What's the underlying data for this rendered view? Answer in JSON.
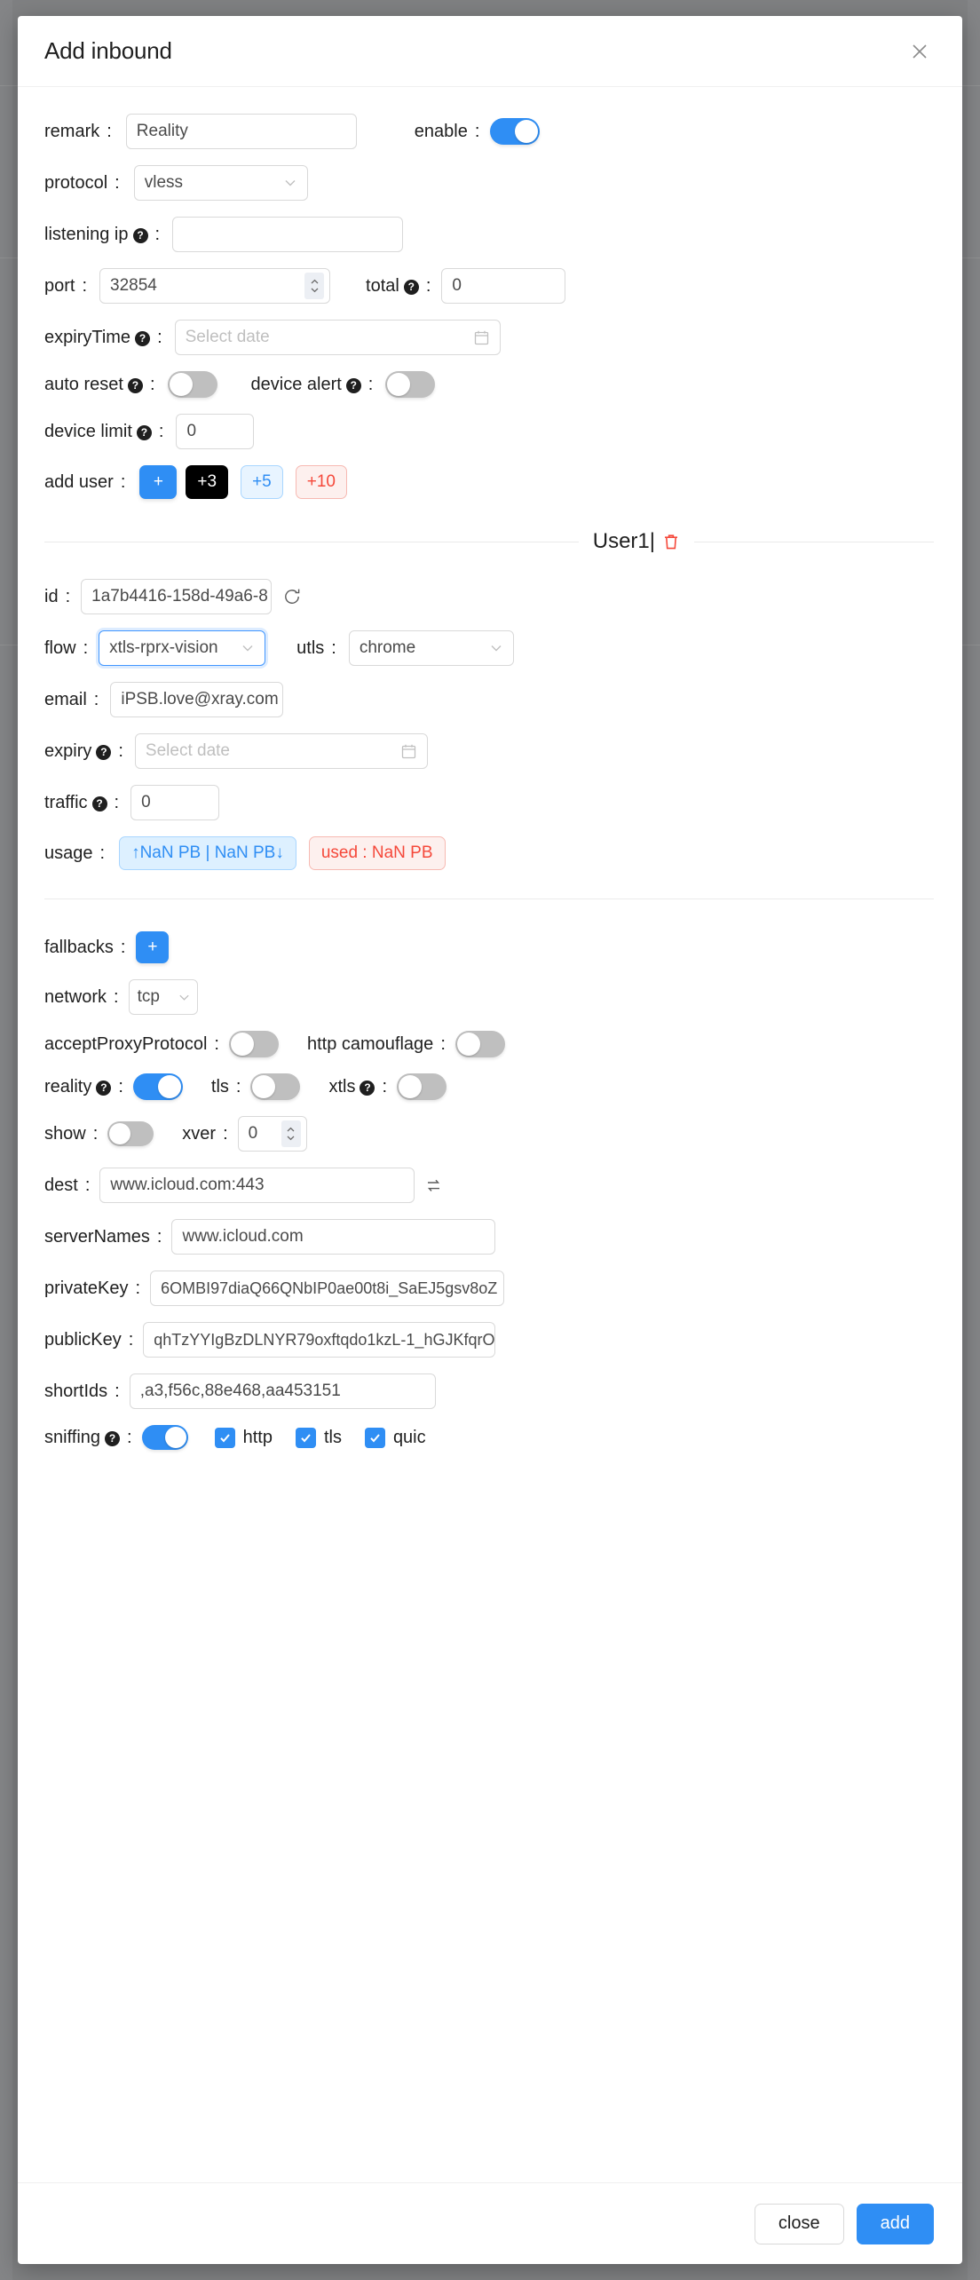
{
  "modal": {
    "title": "Add inbound",
    "close_icon": "close-icon"
  },
  "form": {
    "remark": {
      "label": "remark",
      "value": "Reality"
    },
    "enable": {
      "label": "enable",
      "state": "on"
    },
    "protocol": {
      "label": "protocol",
      "value": "vless"
    },
    "listening_ip": {
      "label": "listening ip",
      "value": ""
    },
    "port": {
      "label": "port",
      "value": "32854"
    },
    "total": {
      "label": "total",
      "value": "0"
    },
    "expiry_time": {
      "label": "expiryTime",
      "placeholder": "Select date",
      "value": ""
    },
    "auto_reset": {
      "label": "auto reset",
      "state": "off"
    },
    "device_alert": {
      "label": "device alert",
      "state": "off"
    },
    "device_limit": {
      "label": "device limit",
      "value": "0"
    },
    "add_user": {
      "label": "add user",
      "buttons": [
        {
          "text": "+",
          "style": "blue"
        },
        {
          "text": "+3",
          "style": "black"
        },
        {
          "text": "+5",
          "style": "lightblue"
        },
        {
          "text": "+10",
          "style": "lightred"
        }
      ]
    }
  },
  "user": {
    "title": "User1|",
    "delete_icon": "trash-icon",
    "id": {
      "label": "id",
      "value": "1a7b4416-158d-49a6-8",
      "refresh_icon": "refresh-icon"
    },
    "flow": {
      "label": "flow",
      "value": "xtls-rprx-vision",
      "focused": true
    },
    "utls": {
      "label": "utls",
      "value": "chrome"
    },
    "email": {
      "label": "email",
      "value": "iPSB.love@xray.com"
    },
    "expiry": {
      "label": "expiry",
      "placeholder": "Select date",
      "value": ""
    },
    "traffic": {
      "label": "traffic",
      "value": "0"
    },
    "usage": {
      "label": "usage",
      "updown": "↑NaN PB | NaN PB↓",
      "used": "used : NaN PB"
    }
  },
  "stream": {
    "fallbacks": {
      "label": "fallbacks",
      "button": "+"
    },
    "network": {
      "label": "network",
      "value": "tcp"
    },
    "accept_proxy_protocol": {
      "label": "acceptProxyProtocol",
      "state": "off"
    },
    "http_camouflage": {
      "label": "http camouflage",
      "state": "off"
    },
    "reality": {
      "label": "reality",
      "state": "on"
    },
    "tls": {
      "label": "tls",
      "state": "off"
    },
    "xtls": {
      "label": "xtls",
      "state": "off"
    },
    "show": {
      "label": "show",
      "state": "off"
    },
    "xver": {
      "label": "xver",
      "value": "0"
    },
    "dest": {
      "label": "dest",
      "value": "www.icloud.com:443",
      "swap_icon": "swap-icon"
    },
    "server_names": {
      "label": "serverNames",
      "value": "www.icloud.com"
    },
    "private_key": {
      "label": "privateKey",
      "value": "6OMBI97diaQ66QNbIP0ae00t8i_SaEJ5gsv8oZ"
    },
    "public_key": {
      "label": "publicKey",
      "value": "qhTzYYIgBzDLNYR79oxftqdo1kzL-1_hGJKfqrO"
    },
    "short_ids": {
      "label": "shortIds",
      "value": ",a3,f56c,88e468,aa453151"
    },
    "sniffing": {
      "label": "sniffing",
      "state": "on",
      "options": [
        {
          "label": "http",
          "checked": true
        },
        {
          "label": "tls",
          "checked": true
        },
        {
          "label": "quic",
          "checked": true
        }
      ]
    }
  },
  "footer": {
    "close_label": "close",
    "add_label": "add"
  },
  "colors": {
    "accent": "#2f8ef4",
    "danger": "#f5483a",
    "backdrop": "#7f8082"
  }
}
